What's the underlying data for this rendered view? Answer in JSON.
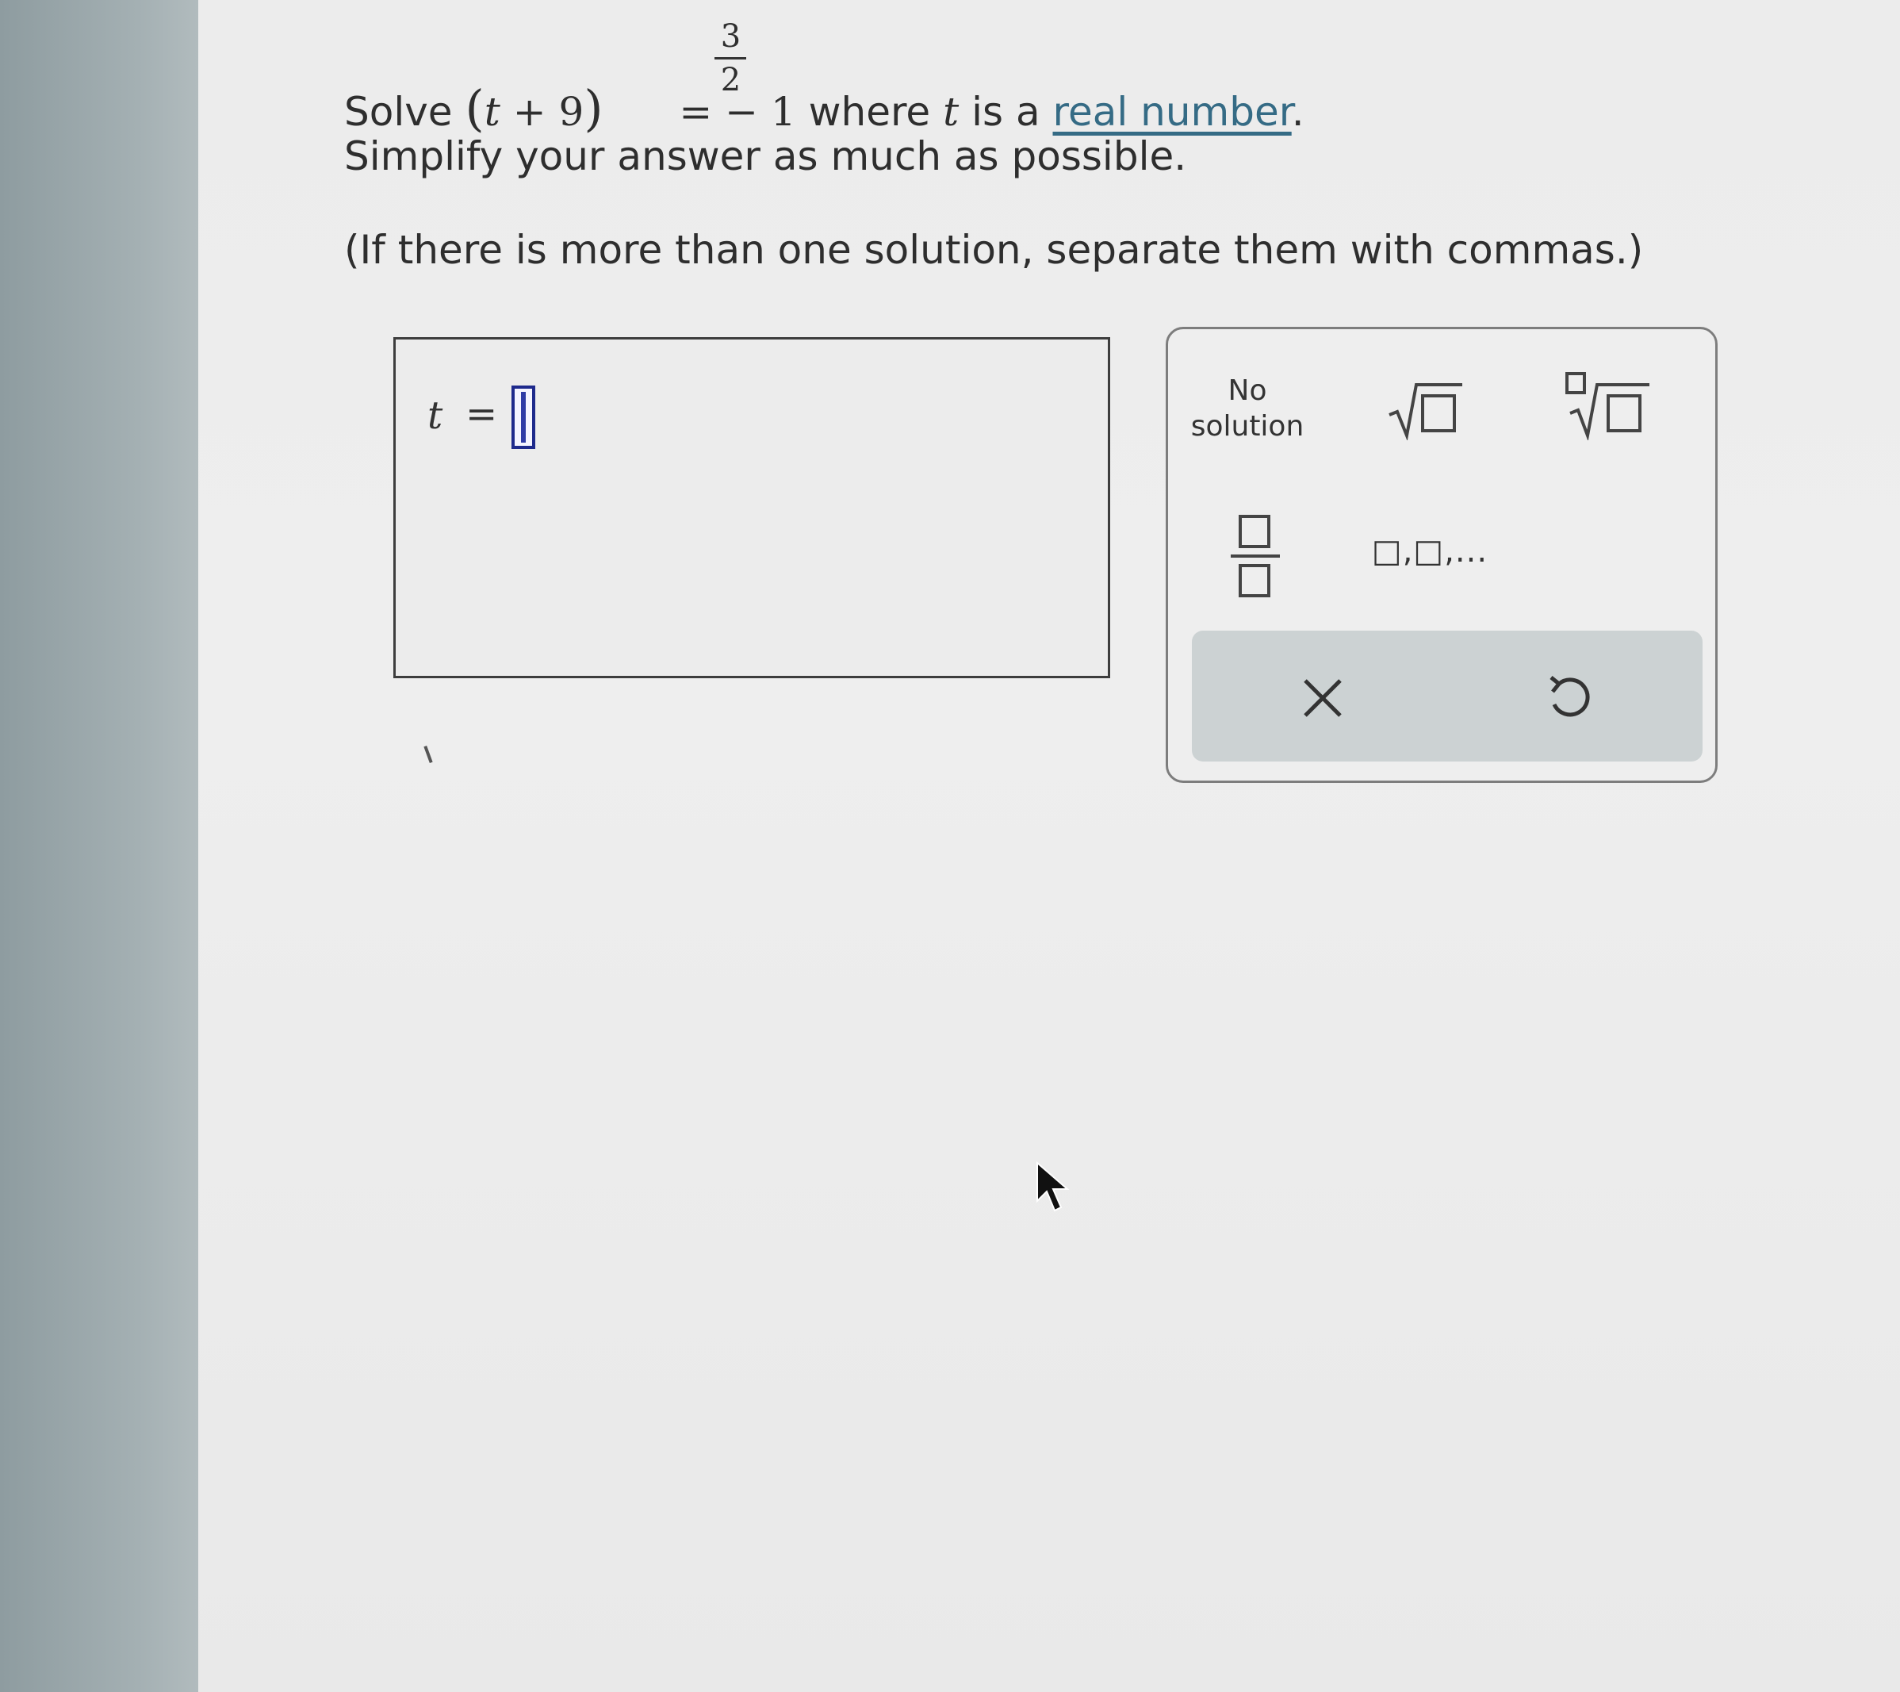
{
  "question": {
    "solve_word": "Solve",
    "base_open": "(",
    "base_var": "t",
    "base_op": "+",
    "base_const": "9",
    "base_close": ")",
    "exponent_numerator": "3",
    "exponent_denominator": "2",
    "rhs": "= − 1",
    "where_text": "where",
    "var_t": "t",
    "is_a_text": "is a",
    "link_text": "real number",
    "period": ".",
    "line2": "Simplify your answer as much as possible.",
    "line3": "(If there is more than one solution, separate them with commas.)"
  },
  "answer": {
    "variable": "t",
    "equals": "=",
    "value": ""
  },
  "keypad": {
    "no_solution_line1": "No",
    "no_solution_line2": "solution",
    "buttons": [
      "no-solution",
      "square-root",
      "nth-root",
      "fraction",
      "list"
    ],
    "list_label": "□,□,...",
    "actions": [
      "clear",
      "undo"
    ]
  },
  "colors": {
    "link": "#356b85",
    "cursor": "#1e2a8c",
    "action_bar": "#ccd2d3"
  }
}
